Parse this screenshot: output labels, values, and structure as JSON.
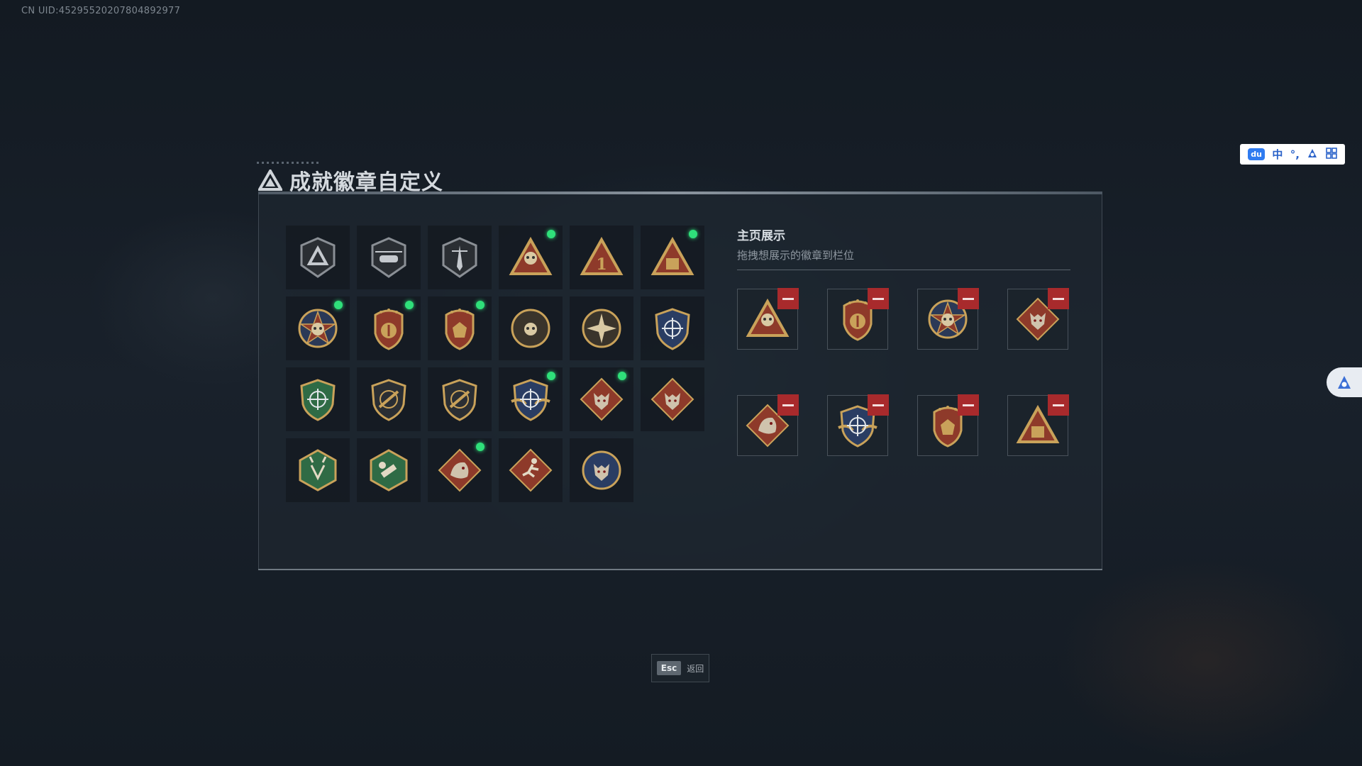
{
  "uid_text": "CN UID:452955202078048929​77",
  "title": "成就徽章自定义",
  "showcase": {
    "title": "主页展示",
    "subtitle": "拖拽想展示的徽章到栏位"
  },
  "badges": [
    {
      "name": "triangle-shield-badge",
      "new": false
    },
    {
      "name": "helicopter-shield-badge",
      "new": false
    },
    {
      "name": "dagger-shield-badge",
      "new": false
    },
    {
      "name": "skull-triangle-badge",
      "new": true
    },
    {
      "name": "number-one-triangle-badge",
      "new": false
    },
    {
      "name": "crate-triangle-badge",
      "new": true
    },
    {
      "name": "star-medal-badge",
      "new": true
    },
    {
      "name": "crest-medal-badge",
      "new": true
    },
    {
      "name": "red-crest-medal-badge",
      "new": true
    },
    {
      "name": "skull-round-badge",
      "new": false
    },
    {
      "name": "spiked-round-badge",
      "new": false
    },
    {
      "name": "blue-crosshair-shield-badge",
      "new": false
    },
    {
      "name": "green-crosshair-shield-badge",
      "new": false
    },
    {
      "name": "rifle-shield-badge",
      "new": false
    },
    {
      "name": "rifle-shield-badge-2",
      "new": false
    },
    {
      "name": "winged-crosshair-badge",
      "new": true
    },
    {
      "name": "wolf-diamond-badge",
      "new": true
    },
    {
      "name": "wolf-diamond-badge-2",
      "new": false
    },
    {
      "name": "goat-hexagon-badge",
      "new": false
    },
    {
      "name": "wrench-hexagon-badge",
      "new": false
    },
    {
      "name": "dragon-diamond-badge",
      "new": true
    },
    {
      "name": "runner-diamond-badge",
      "new": false
    },
    {
      "name": "wolf-round-badge",
      "new": false
    }
  ],
  "slots": [
    "skull-triangle-badge",
    "crest-medal-badge",
    "star-medal-badge",
    "wolf-diamond-badge",
    "dragon-diamond-badge",
    "winged-crosshair-badge",
    "red-crest-medal-badge",
    "crate-triangle-badge"
  ],
  "esc": {
    "key": "Esc",
    "label": "返回"
  },
  "ime": {
    "items": [
      "du",
      "中",
      "°,",
      "A",
      "grid"
    ]
  },
  "colors": {
    "new_dot": "#2fe07a",
    "remove": "#a82a2c",
    "gold": "#c9a25a",
    "red": "#8e3a2a",
    "green": "#2f6b45",
    "blue": "#2a3d63"
  }
}
